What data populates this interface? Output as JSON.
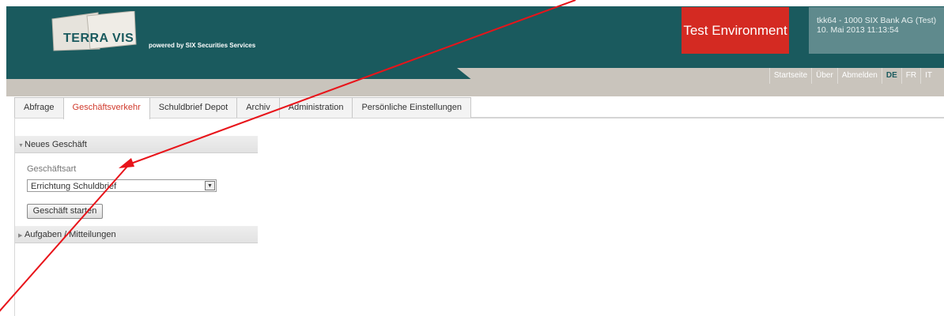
{
  "header": {
    "logo_text": "TERRA VIS",
    "tagline": "powered by SIX Securities Services",
    "environment_badge": "Test Environment",
    "user_line1": "tkk64 - 1000  SIX Bank AG (Test)",
    "user_line2": "10. Mai 2013 11:13:54"
  },
  "utility_nav": [
    {
      "label": "Startseite"
    },
    {
      "label": "Über"
    },
    {
      "label": "Abmelden"
    },
    {
      "label": "DE"
    },
    {
      "label": "FR"
    },
    {
      "label": "IT"
    }
  ],
  "tabs": [
    {
      "label": "Abfrage"
    },
    {
      "label": "Geschäftsverkehr"
    },
    {
      "label": "Schuldbrief Depot"
    },
    {
      "label": "Archiv"
    },
    {
      "label": "Administration"
    },
    {
      "label": "Persönliche Einstellungen"
    }
  ],
  "panel_new": {
    "title": "Neues Geschäft",
    "field_label": "Geschäftsart",
    "select_value": "Errichtung Schuldbrief",
    "start_button": "Geschäft starten"
  },
  "panel_tasks": {
    "title": "Aufgaben / Mitteilungen"
  },
  "colors": {
    "header_bg": "#1a5a5e",
    "badge_red": "#d42a22",
    "active_tab": "#d03a2c",
    "annotation_arrow": "#e8141a"
  }
}
